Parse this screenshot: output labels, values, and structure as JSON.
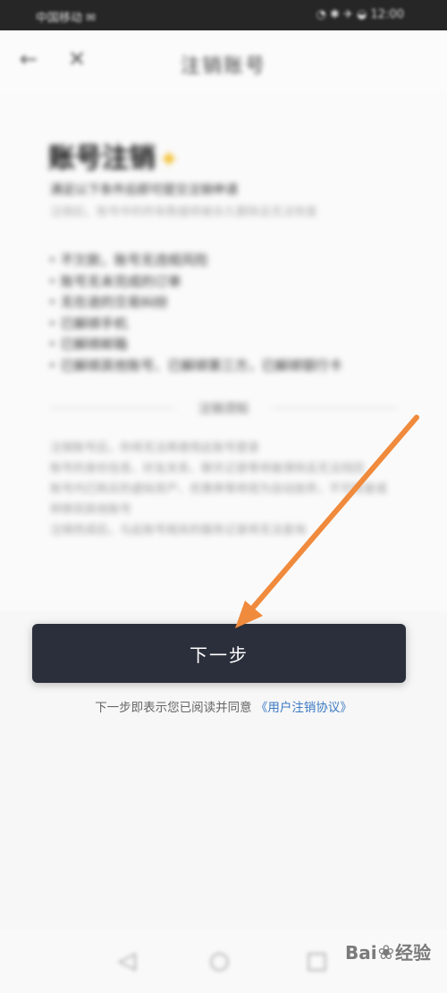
{
  "status_bar": {
    "left": "中国移动 ✉",
    "right": "◔ ✱ ✈ ◒ 12:00"
  },
  "nav": {
    "back_icon": "←",
    "close_icon": "✕",
    "title": "注销账号"
  },
  "content": {
    "heading": "账号注销",
    "heading_emoji": "✦",
    "subtitle": "满足以下条件后即可提交注销申请",
    "subtitle_note": "注销后，账号中的所有数据将被永久删除且无法恢复",
    "conditions": [
      "不欠款，账号无违规风险",
      "账号无未完成的订单",
      "无在途的交易纠纷",
      "已解绑手机",
      "已解绑邮箱",
      "已解绑其他账号、已解绑第三方，已解绑银行卡"
    ],
    "divider_label": "注销须知",
    "notes": [
      "注销账号后，你将无法再使用此账号登录",
      "账号的身份信息、好友关系、聊天记录等将被清除且无法找回",
      "账号内已购买的虚拟资产、优惠券等将视为自动放弃，不可恢复或转移到其他账号",
      "注销完成后，与此账号相关的服务记录将无法查询"
    ]
  },
  "next_button": {
    "label": "下一步"
  },
  "agreement": {
    "prefix": "下一步即表示您已阅读并同意",
    "link": "《用户注销协议》"
  },
  "bottom_nav": {
    "back": "◁",
    "home": "○",
    "recent": "□"
  },
  "watermark": {
    "text_left": "Bai",
    "paw": "❀",
    "text_right": "经验"
  },
  "colors": {
    "button_bg": "#2b2f3b",
    "link": "#3b79c3",
    "arrow": "#f08a3c",
    "emoji": "#f2b60f"
  }
}
